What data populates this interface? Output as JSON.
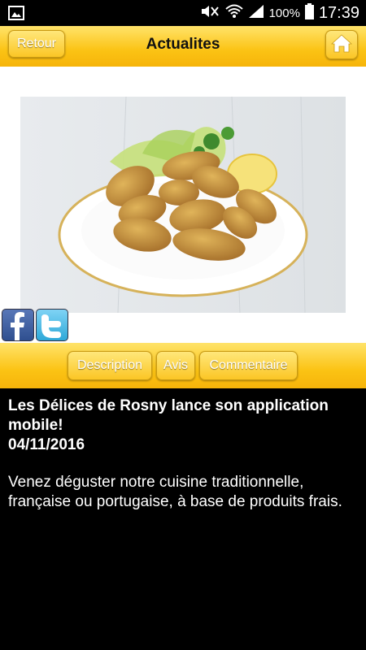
{
  "status_bar": {
    "battery": "100%",
    "time": "17:39"
  },
  "header": {
    "back_label": "Retour",
    "title": "Actualites"
  },
  "tabs": [
    {
      "label": "Description"
    },
    {
      "label": "Avis"
    },
    {
      "label": "Commentaire"
    }
  ],
  "article": {
    "title": "Les Délices de Rosny lance son application mobile!",
    "date": "04/11/2016",
    "body": "Venez déguster notre cuisine traditionnelle, française ou portugaise, à base de produits frais."
  },
  "icons": {
    "gallery": "image-icon",
    "mute": "mute-icon",
    "wifi": "wifi-icon",
    "signal": "signal-icon",
    "battery": "battery-icon",
    "home": "home-icon",
    "facebook": "facebook-icon",
    "twitter": "twitter-icon"
  },
  "colors": {
    "accent": "#fbc314",
    "background": "#000000"
  }
}
